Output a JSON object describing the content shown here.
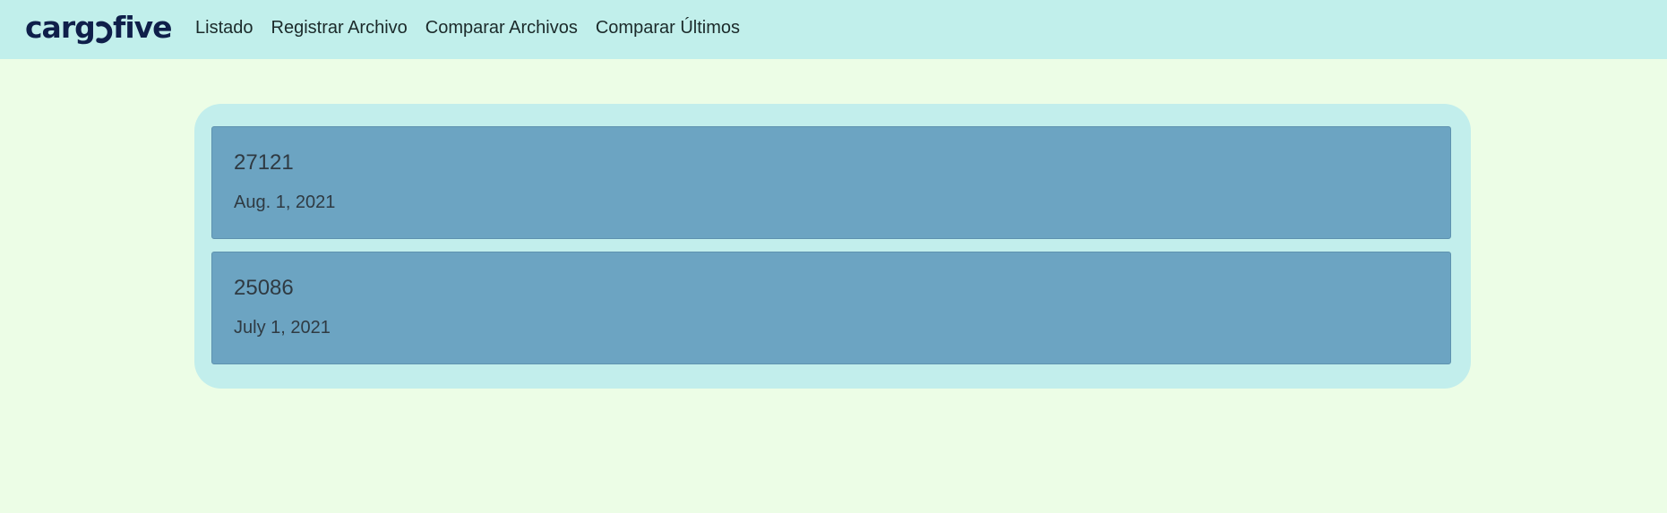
{
  "brand": {
    "name": "cargofive",
    "color": "#0f1f4a"
  },
  "nav": {
    "items": [
      {
        "label": "Listado"
      },
      {
        "label": "Registrar Archivo"
      },
      {
        "label": "Comparar Archivos"
      },
      {
        "label": "Comparar Últimos"
      }
    ]
  },
  "files": [
    {
      "id": "27121",
      "date": "Aug. 1, 2021"
    },
    {
      "id": "25086",
      "date": "July 1, 2021"
    }
  ],
  "colors": {
    "page_bg": "#ecfde6",
    "navbar_bg": "#c1efeb",
    "panel_bg": "#c2eeec",
    "card_bg": "#6ca4c2",
    "text": "#2f3a42"
  }
}
